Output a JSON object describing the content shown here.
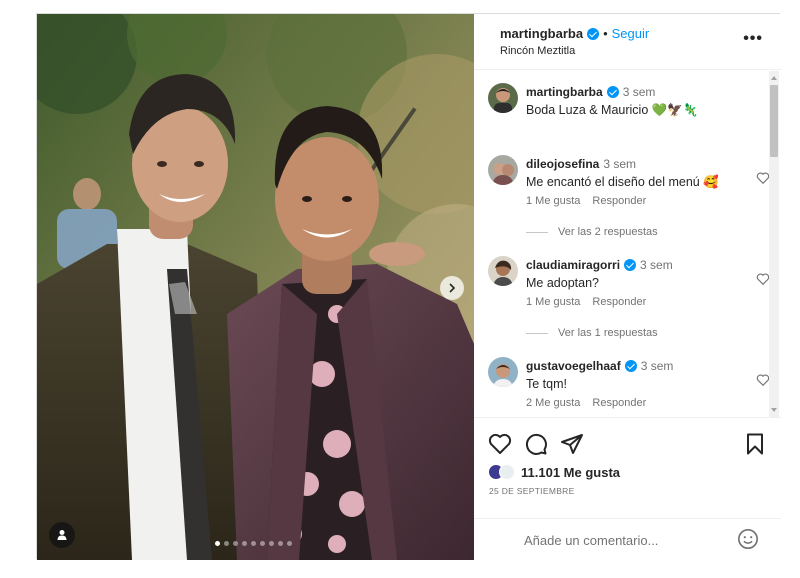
{
  "post": {
    "username": "martingbarba",
    "separator": "•",
    "follow_label": "Seguir",
    "location": "Rincón Meztitla",
    "more_label": "•••",
    "caption": {
      "username": "martingbarba",
      "time": "3 sem",
      "text": "Boda Luza & Mauricio 💚🦅🦎"
    },
    "carousel": {
      "total": 9,
      "current": 1
    }
  },
  "comments": [
    {
      "username": "dileojosefina",
      "verified": false,
      "time": "3 sem",
      "text": "Me encantó el diseño del menú 🥰",
      "likes": "1 Me gusta",
      "reply_label": "Responder",
      "replies_label": "Ver las 2 respuestas"
    },
    {
      "username": "claudiamiragorri",
      "verified": true,
      "time": "3 sem",
      "text": "Me adoptan?",
      "likes": "1 Me gusta",
      "reply_label": "Responder",
      "replies_label": "Ver las 1 respuestas"
    },
    {
      "username": "gustavoegelhaaf",
      "verified": true,
      "time": "3 sem",
      "text": "Te tqm!",
      "likes": "2 Me gusta",
      "reply_label": "Responder"
    }
  ],
  "actions": {
    "icons": [
      "heart-icon",
      "comment-icon",
      "share-icon",
      "bookmark-icon"
    ],
    "likes_label": "11.101 Me gusta",
    "date": "25 DE SEPTIEMBRE",
    "comment_placeholder": "Añade un comentario..."
  },
  "colors": {
    "accent": "#0095f6",
    "text": "#262626",
    "secondary": "#737373",
    "border": "#dbdbdb"
  }
}
